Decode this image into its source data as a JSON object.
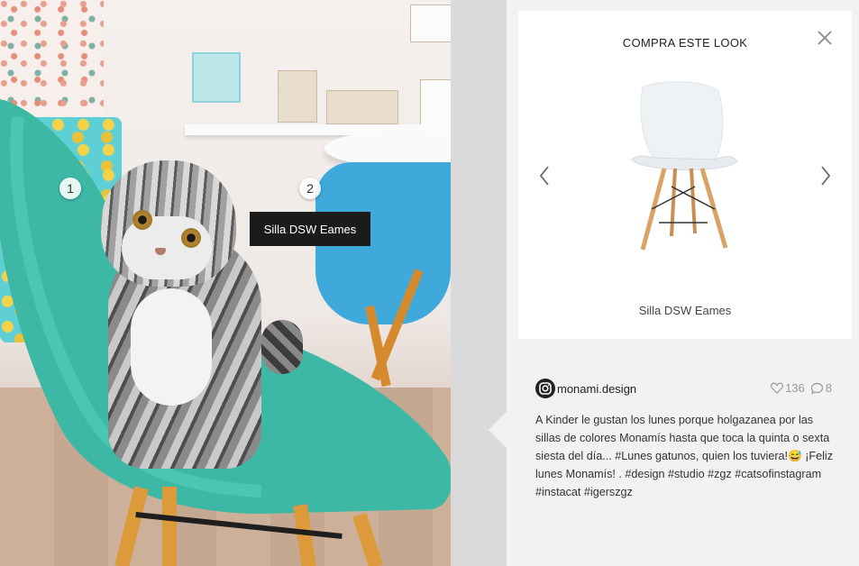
{
  "modal": {
    "title": "COMPRA ESTE LOOK",
    "product_name": "Silla DSW Eames"
  },
  "hotspots": [
    {
      "label": "1"
    },
    {
      "label": "2",
      "tooltip": "Silla DSW Eames"
    }
  ],
  "post": {
    "username": "monami.design",
    "likes": "136",
    "comments": "8",
    "caption": "A Kinder le gustan los lunes porque holgazanea por las sillas de colores Monamís hasta que toca la quinta o sexta siesta del día... #Lunes gatunos, quien los tuviera!😅 ¡Feliz lunes Monamís! . #design #studio #zgz #catsofinstagram #instacat #igerszgz"
  },
  "icons": {
    "close": "close-icon",
    "prev": "chevron-left-icon",
    "next": "chevron-right-icon",
    "instagram": "instagram-icon",
    "heart": "heart-icon",
    "comment": "comment-icon"
  },
  "colors": {
    "mint_chair": "#3cb8a4",
    "blue_chair": "#3fa9dc",
    "wood": "#dd9a3b"
  }
}
